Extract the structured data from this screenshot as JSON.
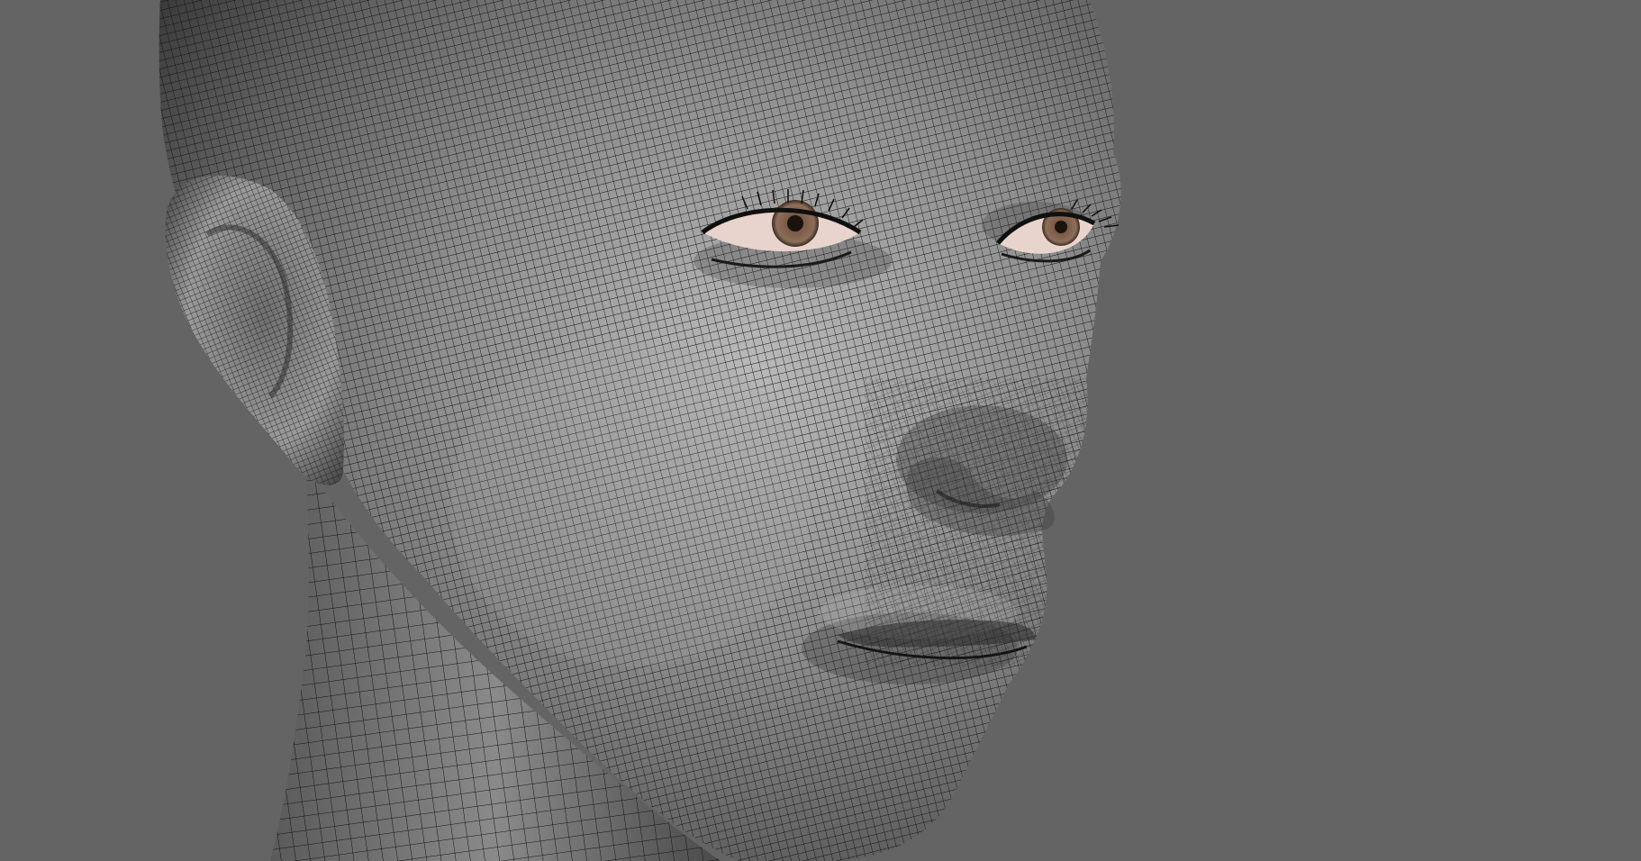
{
  "viewport": {
    "background_color": "#646464",
    "shading": "smooth-shaded-with-wireframe",
    "subject": "head-mesh"
  },
  "mesh": {
    "surface_base_color": "#8a8a8a",
    "surface_highlight_color": "#b4b4b4",
    "surface_shadow_color": "#2e2e2e",
    "wire_color": "#141414",
    "iris_color": "#7a5a46",
    "eye_white_color": "#e8d4cc"
  }
}
